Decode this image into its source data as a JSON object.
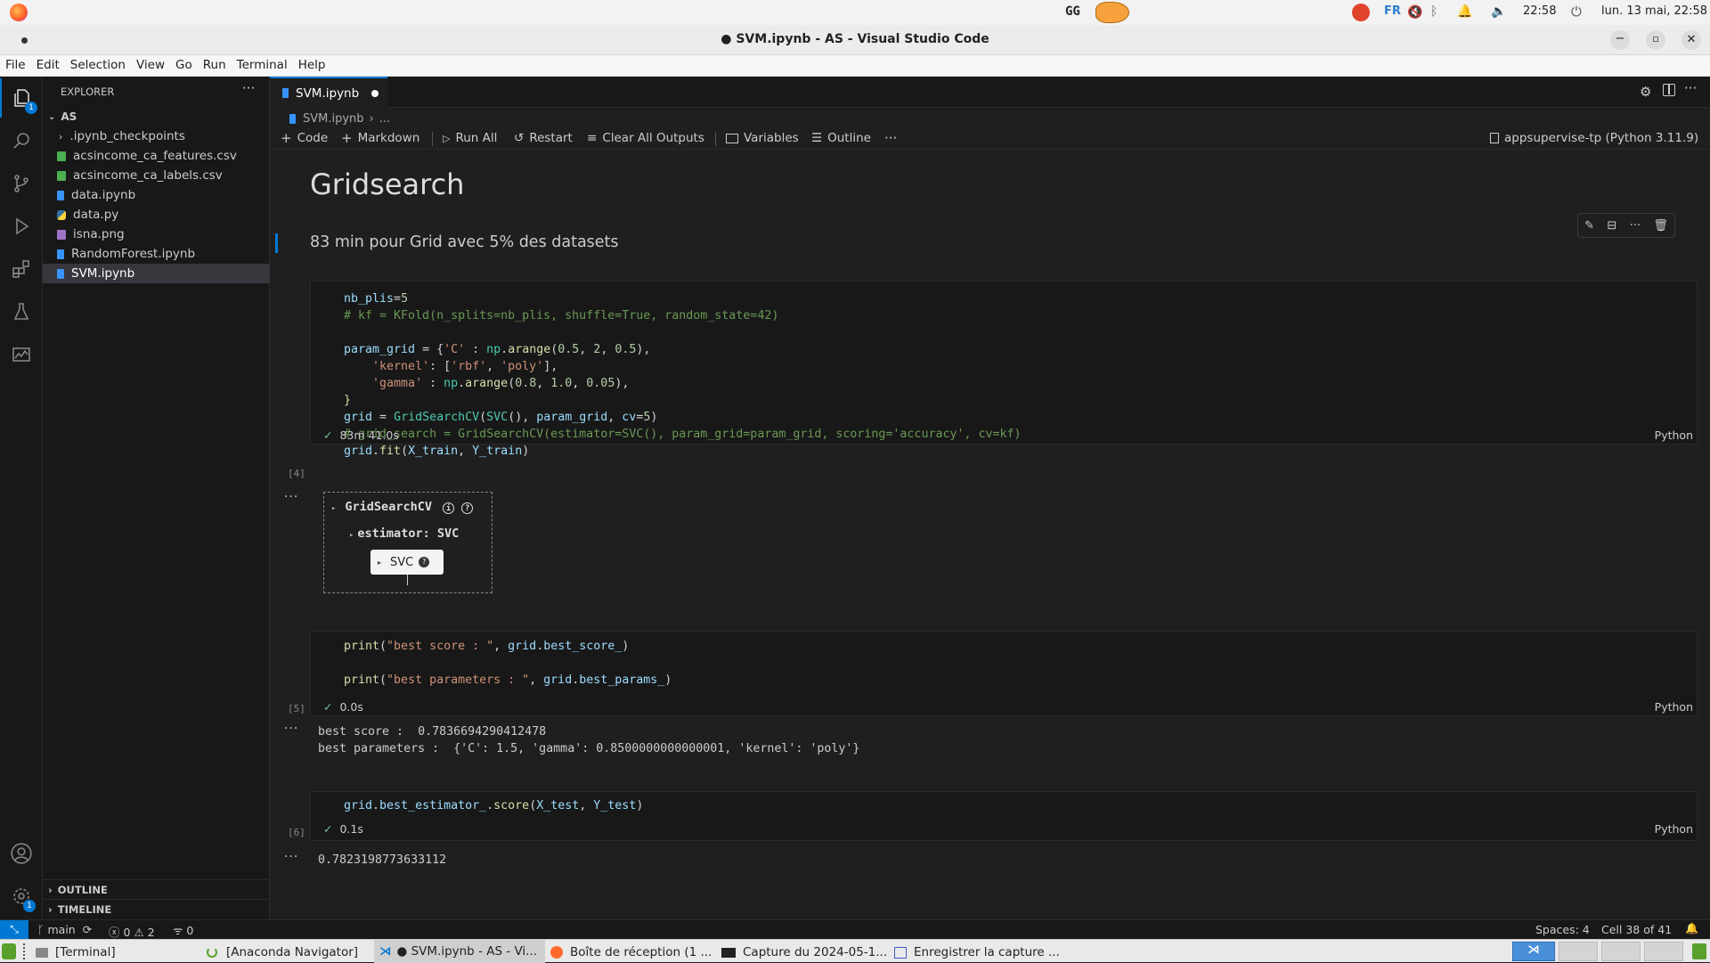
{
  "system_bar": {
    "keyboard": "FR",
    "time": "22:58",
    "datetime": "lun. 13 mai, 22:58"
  },
  "window": {
    "title": "● SVM.ipynb - AS - Visual Studio Code"
  },
  "menu": [
    "File",
    "Edit",
    "Selection",
    "View",
    "Go",
    "Run",
    "Terminal",
    "Help"
  ],
  "activity_badges": {
    "explorer": "1",
    "settings": "1"
  },
  "explorer": {
    "header": "EXPLORER",
    "folder": "AS",
    "items": [
      {
        "label": ".ipynb_checkpoints",
        "type": "folder"
      },
      {
        "label": "acsincome_ca_features.csv",
        "type": "csv"
      },
      {
        "label": "acsincome_ca_labels.csv",
        "type": "csv"
      },
      {
        "label": "data.ipynb",
        "type": "notebook"
      },
      {
        "label": "data.py",
        "type": "python"
      },
      {
        "label": "isna.png",
        "type": "image"
      },
      {
        "label": "RandomForest.ipynb",
        "type": "notebook"
      },
      {
        "label": "SVM.ipynb",
        "type": "notebook",
        "selected": true
      }
    ],
    "outline": "OUTLINE",
    "timeline": "TIMELINE"
  },
  "tab": {
    "label": "SVM.ipynb"
  },
  "breadcrumb": {
    "file": "SVM.ipynb",
    "more": "..."
  },
  "toolbar": {
    "code": "Code",
    "markdown": "Markdown",
    "run_all": "Run All",
    "restart": "Restart",
    "clear": "Clear All Outputs",
    "variables": "Variables",
    "outline": "Outline",
    "kernel": "appsupervise-tp (Python 3.11.9)"
  },
  "markdown": {
    "heading": "Gridsearch",
    "text": "83 min pour Grid avec 5% des datasets"
  },
  "cells": {
    "c4": {
      "exec": "[4]",
      "time": "83m 41.0s",
      "lang": "Python"
    },
    "c5": {
      "exec": "[5]",
      "time": "0.0s",
      "lang": "Python"
    },
    "c6": {
      "exec": "[6]",
      "time": "0.1s",
      "lang": "Python"
    }
  },
  "widget": {
    "title": "GridSearchCV",
    "estimator": "estimator: SVC",
    "svc": "SVC"
  },
  "outputs": {
    "o5_line1": "best score :  0.7836694290412478",
    "o5_line2": "best parameters :  {'C': 1.5, 'gamma': 0.8500000000000001, 'kernel': 'poly'}",
    "o6": "0.7823198773633112"
  },
  "status": {
    "branch": "main",
    "errors": "0",
    "warnings": "2",
    "ports": "0",
    "spaces": "Spaces: 4",
    "cell": "Cell 38 of 41"
  },
  "taskbar": {
    "items": [
      "[Terminal]",
      "[Anaconda Navigator]",
      "● SVM.ipynb - AS - Vi...",
      "Boîte de réception (1 ...",
      "Capture du 2024-05-1...",
      "Enregistrer la capture ..."
    ]
  }
}
